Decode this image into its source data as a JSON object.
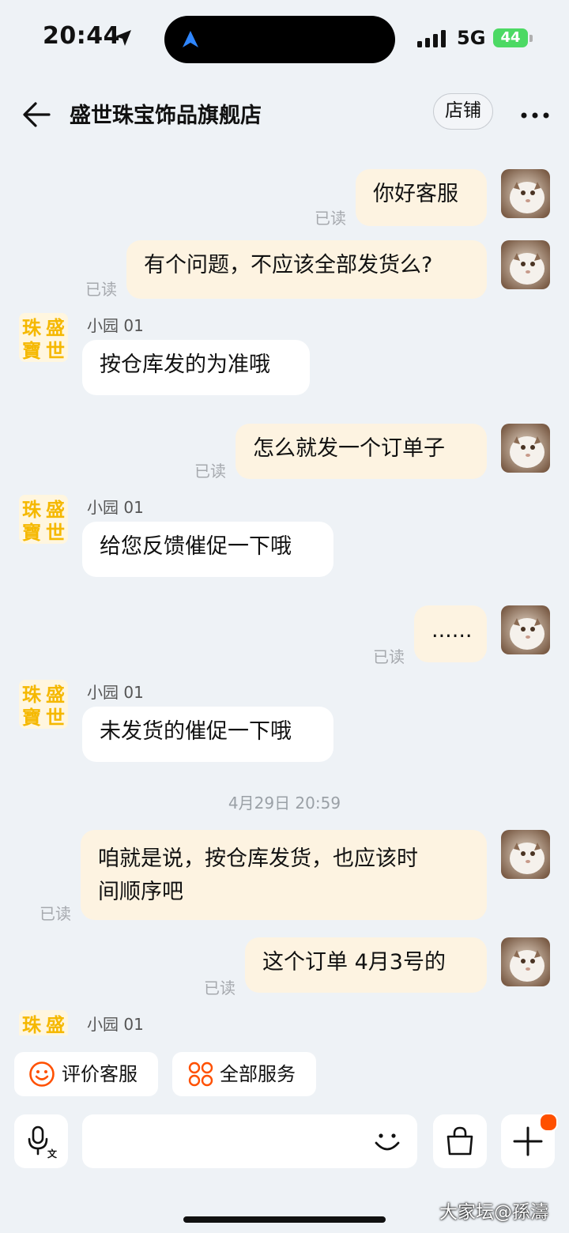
{
  "status": {
    "time": "20:44",
    "network": "5G",
    "battery": "44"
  },
  "header": {
    "title": "盛世珠宝饰品旗舰店",
    "store_button": "店铺"
  },
  "store_avatar": {
    "chars": [
      "珠",
      "盛",
      "寶",
      "世"
    ]
  },
  "messages": {
    "m1": {
      "text": "你好客服",
      "status": "已读"
    },
    "m2": {
      "text": "有个问题，不应该全部发货么?",
      "status": "已读"
    },
    "m3": {
      "sender": "小园 01",
      "text": "按仓库发的为准哦"
    },
    "m4": {
      "text": "怎么就发一个订单子",
      "status": "已读"
    },
    "m5": {
      "sender": "小园 01",
      "text": "给您反馈催促一下哦"
    },
    "m6": {
      "text": "......",
      "status": "已读"
    },
    "m7": {
      "sender": "小园 01",
      "text": "未发货的催促一下哦"
    },
    "timestamp": "4月29日 20:59",
    "m8": {
      "line1": "咱就是说，按仓库发货，也应该时",
      "line2": "间顺序吧",
      "status": "已读"
    },
    "m9": {
      "text": "这个订单 4月3号的",
      "status": "已读"
    },
    "m10": {
      "sender": "小园 01"
    }
  },
  "quick_actions": {
    "rate": "评价客服",
    "services": "全部服务"
  },
  "colors": {
    "accent": "#ff5000",
    "my_bubble": "#fdf3e1",
    "store_gold": "#f5b800"
  },
  "watermark": "大家坛@孫濤"
}
